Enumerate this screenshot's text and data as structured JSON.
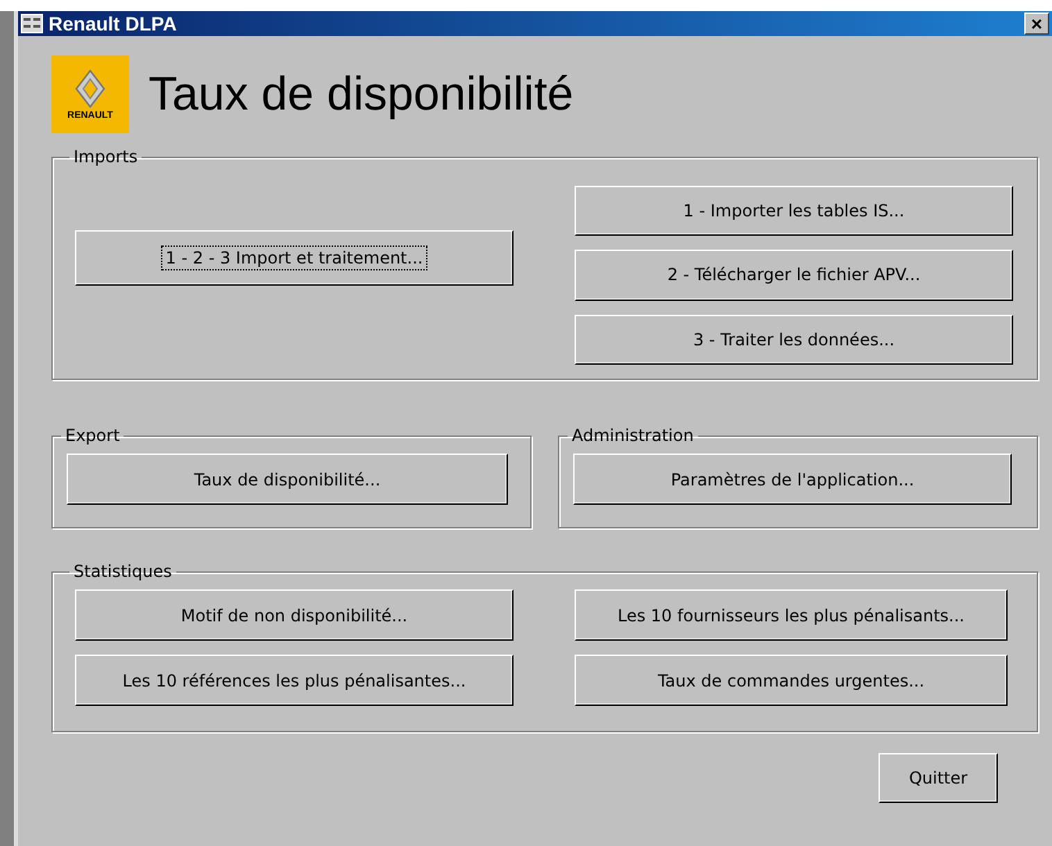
{
  "window": {
    "title": "Renault DLPA",
    "close": "×"
  },
  "logo": {
    "brand": "RENAULT"
  },
  "heading": "Taux de disponibilité",
  "imports": {
    "legend": "Imports",
    "main_button": {
      "label": "1 - 2 - 3  Import et traitement...",
      "focused": true
    },
    "steps": [
      {
        "label": "1 - Importer les tables IS...",
        "focused": false
      },
      {
        "label": "2 - Télécharger le fichier APV...",
        "focused": false
      },
      {
        "label": "3 - Traiter les données...",
        "focused": false
      }
    ]
  },
  "export": {
    "legend": "Export",
    "buttons": [
      {
        "label": "Taux de disponibilité...",
        "focused": false
      }
    ]
  },
  "administration": {
    "legend": "Administration",
    "buttons": [
      {
        "label": "Paramètres de l'application...",
        "focused": false
      }
    ]
  },
  "statistiques": {
    "legend": "Statistiques",
    "buttons": [
      {
        "label": "Motif de non disponibilité...",
        "focused": false
      },
      {
        "label": "Les 10 fournisseurs les plus pénalisants...",
        "focused": false
      },
      {
        "label": "Les 10 références les plus pénalisantes...",
        "focused": false
      },
      {
        "label": "Taux de commandes urgentes...",
        "focused": false
      }
    ]
  },
  "quit_button": {
    "label": "Quitter",
    "focused": false
  }
}
